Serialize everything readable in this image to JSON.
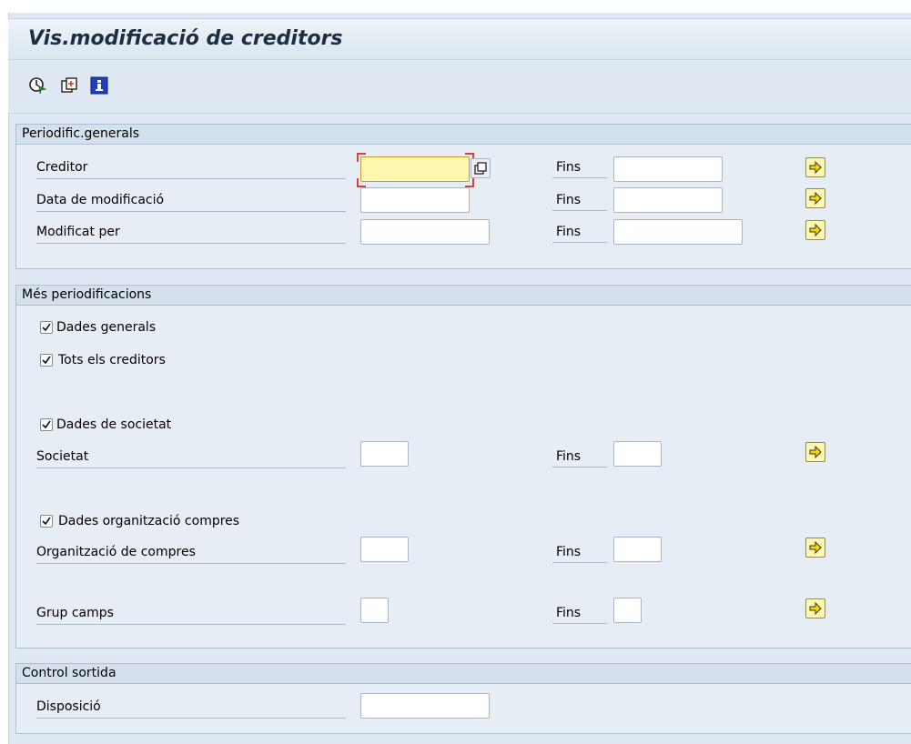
{
  "window": {
    "title": "Vis.modificació de creditors"
  },
  "toolbar": {
    "icons": [
      "execute-icon",
      "get-variant-icon",
      "program-info-icon"
    ]
  },
  "general": {
    "title": "Periodific.generals",
    "creditor_label": "Creditor",
    "creditor_value": "",
    "data_label": "Data de modificació",
    "modificat_label": "Modificat per",
    "fins_label": "Fins"
  },
  "more": {
    "title": "Més periodificacions",
    "dades_generals": "Dades generals",
    "tots_creditors": "Tots els creditors",
    "dades_societat": "Dades de societat",
    "societat": "Societat",
    "dades_org": "Dades organització compres",
    "org_compres": "Organització de compres",
    "grup_camps": "Grup camps",
    "fins_label": "Fins"
  },
  "output": {
    "title": "Control sortida",
    "disposicio": "Disposició"
  },
  "colors": {
    "background": "#dfe8f2",
    "group_header": "#d4e0ec",
    "focus_field": "#fff6b0",
    "arrow_button": "#fff7b0"
  }
}
